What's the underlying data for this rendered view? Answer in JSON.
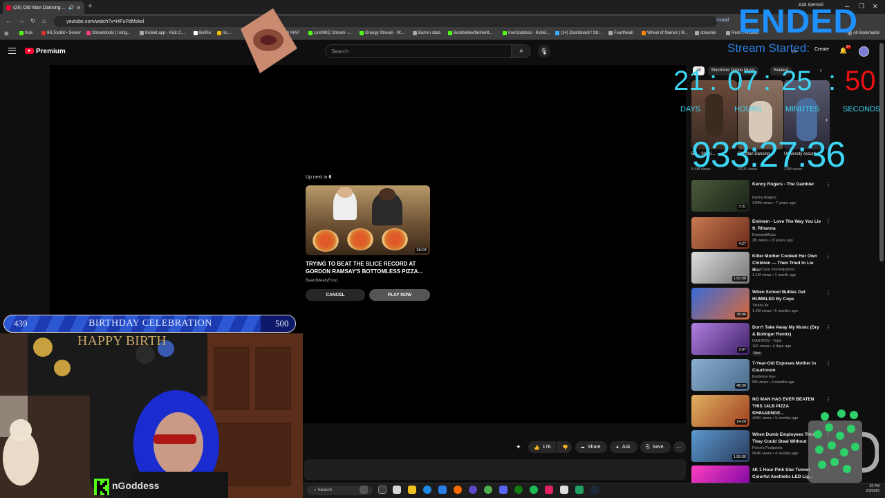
{
  "browser": {
    "tab_title": "(28) Old Man Dancing to K...",
    "url": "youtube.com/watch?v=i4FuPdMskel",
    "install_label": "Install",
    "ask_gemini": "Ask Gemini",
    "all_bookmarks": "All Bookmarks",
    "bookmarks": [
      {
        "label": "Kick",
        "color": "#53fc18"
      },
      {
        "label": "IRLToolkit • Server",
        "color": "#e03030"
      },
      {
        "label": "Streamloots | Irong...",
        "color": "#ff3d7f"
      },
      {
        "label": "Kicklet.app - Kick C...",
        "color": "#aaaaaa"
      },
      {
        "label": "BotRix",
        "color": "#ffffff"
      },
      {
        "label": "Iro...",
        "color": "#f0c000"
      },
      {
        "label": "MAP",
        "color": "#888888"
      },
      {
        "label": "LinsMKD Stream -...",
        "color": "#53fc18"
      },
      {
        "label": "Grungy Stream - W...",
        "color": "#53fc18"
      },
      {
        "label": "Barren stats",
        "color": "#aaaaaa"
      },
      {
        "label": "Bumblebeefarmer8...",
        "color": "#53fc18"
      },
      {
        "label": "IronGoddess - KickB...",
        "color": "#53fc18"
      },
      {
        "label": "(14) Dashboard / Str...",
        "color": "#3ea8ff"
      },
      {
        "label": "Fourthwall",
        "color": "#aaaaaa"
      },
      {
        "label": "Wheel of Names | R...",
        "color": "#ff8800"
      },
      {
        "label": "streamin",
        "color": "#aaaaaa"
      },
      {
        "label": "Rem... Archivo",
        "color": "#aaaaaa"
      }
    ]
  },
  "youtube": {
    "brand": "Premium",
    "search_placeholder": "Search",
    "notification_count": "9+",
    "create_label": "Create"
  },
  "player": {
    "upnext_prefix": "Up next in",
    "upnext_seconds": "6",
    "upnext_duration": "16:04",
    "upnext_title": "TRYING TO BEAT THE SLICE RECORD AT GORDON RAMSAY'S BOTTOMLESS PIZZA...",
    "upnext_channel": "BeardMeatsFood",
    "cancel_label": "CANCEL",
    "play_now_label": "PLAY NOW"
  },
  "actions": {
    "likes": "17K",
    "share": "Share",
    "ask": "Ask",
    "save": "Save"
  },
  "sidebar": {
    "chips": [
      "All",
      "Electronic Dance Music",
      "Related"
    ],
    "shorts": [
      {
        "caption": "Bo... Shaki...",
        "views": "5.5M views"
      },
      {
        "caption": "Old Man Dancing...",
        "views": "231K views"
      },
      {
        "caption": "University security...",
        "views": "12M views"
      }
    ],
    "videos": [
      {
        "title": "Kenny Rogers - The Gambler",
        "channel": "Kenny Rogers",
        "meta": "340M views • 7 years ago",
        "duration": "3:31"
      },
      {
        "title": "Eminem - Love The Way You Lie ft. Rihanna",
        "channel": "EminemMusic",
        "meta": "3B views • 15 years ago",
        "duration": "4:27"
      },
      {
        "title": "Killer Mother Cooked Her Own Children — Then Tried to Lie H...",
        "channel": "DeepCase Interrogations",
        "meta": "1.1M views • 1 month ago",
        "duration": "1:50:39"
      },
      {
        "title": "When School Bullies Get HUMBLED By Cops",
        "channel": "ThisIsLife",
        "meta": "1.2M views • 5 months ago",
        "duration": "38:06"
      },
      {
        "title": "Don't Take Away My Music (Dry & Bolinger Remix)",
        "channel": "DAN:ROS - Topic",
        "meta": "100 views • 4 days ago",
        "duration": "3:07",
        "badge": "New"
      },
      {
        "title": "7-Year-Old Exposes Mother in Courtroom",
        "channel": "Evidence Eye",
        "meta": "5M views • 4 months ago",
        "duration": "48:36"
      },
      {
        "title": "NO MAN HAS EVER BEATEN THIS 14LB PIZZA CHALLENGE...",
        "channel": "Scott Eats",
        "meta": "426K views • 5 months ago",
        "duration": "14:29"
      },
      {
        "title": "When Dumb Employees Think They Could Steal Without",
        "channel": "Felon's Footprints",
        "meta": "564K views • 4 months ago",
        "duration": "1:55:30"
      },
      {
        "title": "4K 1 Hour Pink Star Tunnel Colorful Aesthetic LED Lig...",
        "channel": "",
        "meta": "",
        "duration": ""
      }
    ]
  },
  "overlay": {
    "ended": "ENDED",
    "stream_started": "Stream Started:",
    "countdown": {
      "days": "21",
      "hours": "07",
      "minutes": "25",
      "seconds": "50"
    },
    "labels": {
      "days": "DAYS",
      "hours": "HOURS",
      "minutes": "MINUTES",
      "seconds": "SECONDS"
    },
    "elapsed": "933:27:36",
    "birthday": {
      "current": "439",
      "title": "BIRTHDAY CELEBRATION",
      "goal": "500",
      "progress_fraction": 0.878
    },
    "webcam_name": "nGoddess",
    "banner_text": "HAPPY BIRTH"
  },
  "taskbar": {
    "search_label": "Search",
    "time": "25 PM",
    "date": "2/3/2026"
  }
}
